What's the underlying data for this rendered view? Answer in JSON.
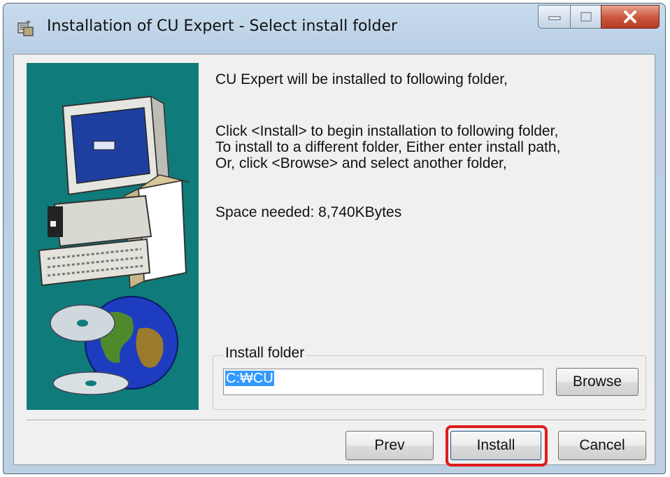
{
  "window": {
    "title": "Installation of CU Expert - Select install folder",
    "controls": [
      "minimize",
      "maximize",
      "close"
    ]
  },
  "content": {
    "intro": "CU Expert will be installed to following folder,",
    "instructions": "Click <Install> to begin installation to following folder,\nTo install to a different folder, Either enter install path,\nOr, click <Browse> and select another folder,",
    "space_needed": "Space needed: 8,740KBytes"
  },
  "install_folder": {
    "label": "Install folder",
    "path": "C:\\CU",
    "path_display": "C:₩CU",
    "browse_label": "Browse"
  },
  "buttons": {
    "prev": "Prev",
    "install": "Install",
    "cancel": "Cancel"
  },
  "highlight": {
    "target": "install-button",
    "color": "#e01b1b"
  },
  "colors": {
    "banner_bg": "#0f7b7b",
    "selection": "#3399ff",
    "close_button": "#c9553b"
  }
}
